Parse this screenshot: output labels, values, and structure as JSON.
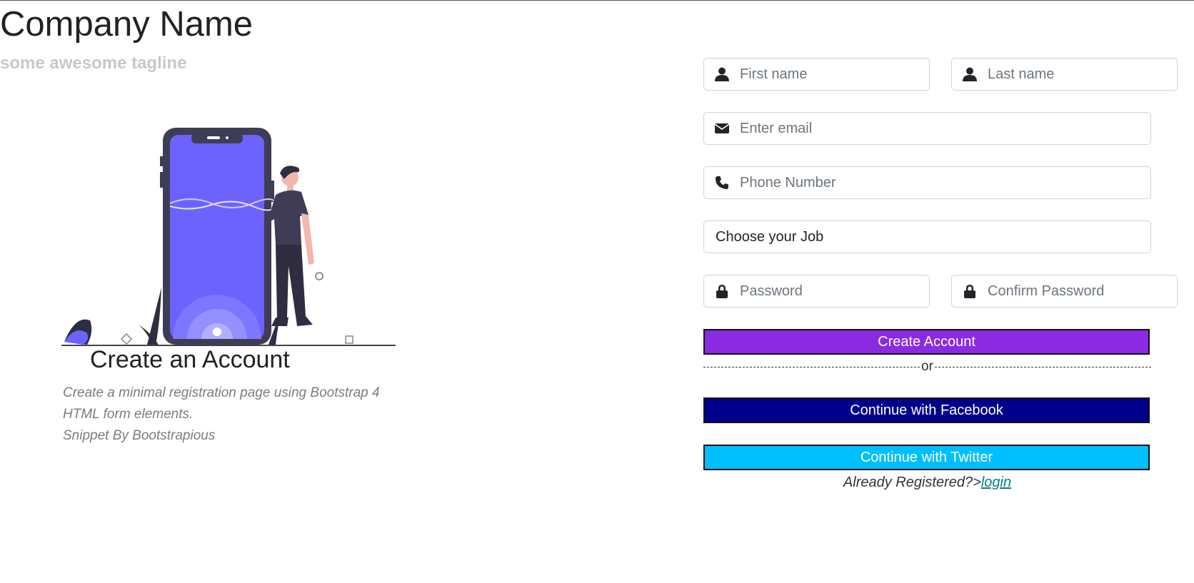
{
  "brand": {
    "name": "Company Name",
    "tagline": "some awesome tagline"
  },
  "intro": {
    "title": "Create an Account",
    "description_line1": "Create a minimal registration page using Bootstrap 4",
    "description_line2": "HTML form elements.",
    "credit": "Snippet By Bootstrapious"
  },
  "form": {
    "first_name": {
      "placeholder": "First name",
      "value": ""
    },
    "last_name": {
      "placeholder": "Last name",
      "value": ""
    },
    "email": {
      "placeholder": "Enter email",
      "value": ""
    },
    "phone": {
      "placeholder": "Phone Number",
      "value": ""
    },
    "job_select": {
      "selected": "Choose your Job"
    },
    "password": {
      "placeholder": "Password",
      "value": ""
    },
    "confirm_password": {
      "placeholder": "Confirm Password",
      "value": ""
    },
    "create_button": "Create Account",
    "divider_text": "or",
    "facebook_button": "Continue with Facebook",
    "twitter_button": "Continue with Twitter",
    "already_text": "Already Registered?>",
    "login_link": "login"
  },
  "icons": {
    "first_name": "user-icon",
    "last_name": "user-icon",
    "email": "envelope-icon",
    "phone": "phone-icon",
    "password": "lock-icon",
    "confirm_password": "lock-icon"
  },
  "colors": {
    "create_button": "#8a2be2",
    "facebook_button": "#00008b",
    "twitter_button": "#00bfff",
    "login_link": "#008080",
    "illustration_accent": "#6c63ff"
  }
}
